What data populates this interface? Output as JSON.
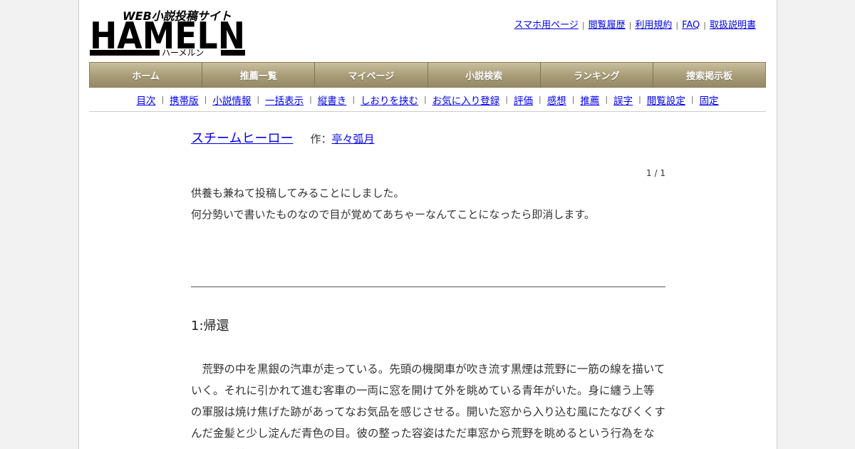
{
  "header": {
    "logo_tagline": "WEB小説投稿サイト",
    "logo_text": "HAMELN",
    "logo_kana": "ハーメルン",
    "top_links": [
      "スマホ用ページ",
      "閲覧履歴",
      "利用規約",
      "FAQ",
      "取扱説明書"
    ]
  },
  "main_nav": [
    "ホーム",
    "推薦一覧",
    "マイページ",
    "小説検索",
    "ランキング",
    "捜索掲示板"
  ],
  "sub_nav": [
    "目次",
    "携帯版",
    "小説情報",
    "一括表示",
    "縦書き",
    "しおりを挟む",
    "お気に入り登録",
    "評価",
    "感想",
    "推薦",
    "誤字",
    "閲覧設定",
    "固定"
  ],
  "novel": {
    "title": "スチームヒーロー",
    "author_label": "作：",
    "author": "亭々弧月",
    "page_count": "1 / 1",
    "preface": [
      "供養も兼ねて投稿してみることにしました。",
      "何分勢いで書いたものなので目が覚めてあちゃーなんてことになったら即消します。"
    ],
    "chapter_title": "1:帰還",
    "body": "荒野の中を黒銀の汽車が走っている。先頭の機関車が吹き流す黒煙は荒野に一筋の線を描いていく。それに引かれて進む客車の一両に窓を開けて外を眺めている青年がいた。身に纏う上等の軍服は焼け焦げた跡があってなお気品を感じさせる。開いた窓から入り込む風にたなびくくすんだ金髪と少し淀んだ青色の目。彼の整った容姿はただ車窓から荒野を眺めるという行為をなにか儚く美しく見せていた。"
  },
  "colors": {
    "nav_gradient_top": "#c9bf9e",
    "nav_gradient_bottom": "#958a66",
    "link": "#0000ee",
    "page_bg": "#f2f2f2"
  }
}
